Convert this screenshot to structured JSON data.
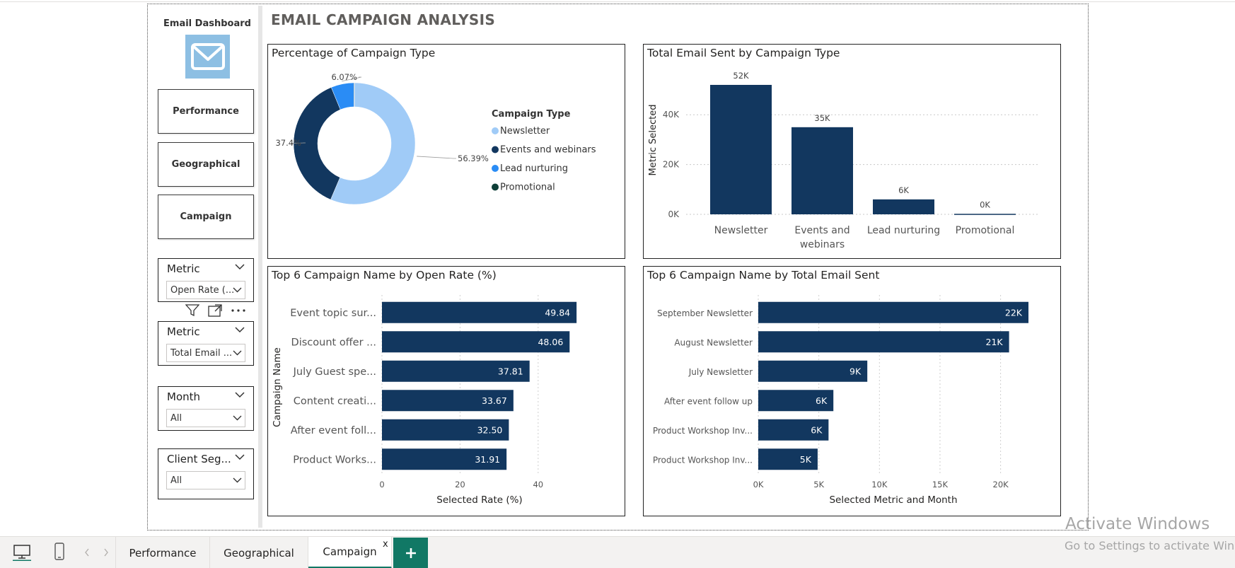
{
  "nav": {
    "dashboard_title": "Email Dashboard",
    "buttons": [
      {
        "label": "Performance"
      },
      {
        "label": "Geographical"
      },
      {
        "label": "Campaign"
      }
    ]
  },
  "slicers": [
    {
      "title": "Metric",
      "value": "Open Rate (..."
    },
    {
      "title": "Metric",
      "value": "Total Email ..."
    },
    {
      "title": "Month",
      "value": "All"
    },
    {
      "title": "Client Seg...",
      "value": "All"
    }
  ],
  "page_title": "EMAIL CAMPAIGN ANALYSIS",
  "colors": {
    "newsletter": "#a0cbf7",
    "events": "#12375f",
    "lead": "#2a8cf5",
    "promotional": "#0e3f38",
    "bar": "#12375f",
    "tab_accent": "#117865"
  },
  "chart_data": [
    {
      "type": "pie",
      "title": "Percentage of Campaign Type",
      "legend_title": "Campaign Type",
      "legend_position": "right",
      "slices": [
        {
          "name": "Newsletter",
          "value": 56.39,
          "label": "56.39%"
        },
        {
          "name": "Events and webinars",
          "value": 37.4,
          "label": "37.4%"
        },
        {
          "name": "Lead nurturing",
          "value": 6.07,
          "label": "6.07%"
        },
        {
          "name": "Promotional",
          "value": 0.14,
          "label": ""
        }
      ]
    },
    {
      "type": "bar",
      "title": "Total Email Sent by Campaign Type",
      "ylabel": "Metric Selected",
      "xlabel": "",
      "categories": [
        "Newsletter",
        "Events and webinars",
        "Lead nurturing",
        "Promotional"
      ],
      "category_lines": [
        [
          "Newsletter"
        ],
        [
          "Events and",
          "webinars"
        ],
        [
          "Lead nurturing"
        ],
        [
          "Promotional"
        ]
      ],
      "values": [
        52000,
        35000,
        6000,
        200
      ],
      "data_labels": [
        "52K",
        "35K",
        "6K",
        "0K"
      ],
      "ylim": [
        0,
        52000
      ],
      "yticks": [
        0,
        20000,
        40000
      ],
      "ytick_labels": [
        "0K",
        "20K",
        "40K"
      ],
      "grid": true
    },
    {
      "type": "bar",
      "orientation": "horizontal",
      "title": "Top 6 Campaign Name by Open Rate (%)",
      "ylabel": "Campaign Name",
      "xlabel": "Selected Rate (%)",
      "categories": [
        "Event topic sur...",
        "Discount offer ...",
        "July Guest spe...",
        "Content creati...",
        "After event foll...",
        "Product Works..."
      ],
      "values": [
        49.84,
        48.06,
        37.81,
        33.67,
        32.5,
        31.91
      ],
      "data_labels": [
        "49.84",
        "48.06",
        "37.81",
        "33.67",
        "32.50",
        "31.91"
      ],
      "xlim": [
        0,
        50
      ],
      "xticks": [
        0,
        20,
        40
      ],
      "xtick_labels": [
        "0",
        "20",
        "40"
      ],
      "grid": true
    },
    {
      "type": "bar",
      "orientation": "horizontal",
      "title": "Top 6 Campaign Name by Total Email Sent",
      "ylabel": "",
      "xlabel": "Selected Metric and Month",
      "categories": [
        "September Newsletter",
        "August Newsletter",
        "July Newsletter",
        "After event follow up",
        "Product Workshop Inv...",
        "Product Workshop Inv..."
      ],
      "values": [
        22300,
        20700,
        9000,
        6200,
        5800,
        4900
      ],
      "data_labels": [
        "22K",
        "21K",
        "9K",
        "6K",
        "6K",
        "5K"
      ],
      "xlim": [
        0,
        22300
      ],
      "xticks": [
        0,
        5000,
        10000,
        15000,
        20000
      ],
      "xtick_labels": [
        "0K",
        "5K",
        "10K",
        "15K",
        "20K"
      ],
      "grid": true
    }
  ],
  "tabs": [
    {
      "label": "Performance",
      "active": false
    },
    {
      "label": "Geographical",
      "active": false
    },
    {
      "label": "Campaign",
      "active": true
    }
  ],
  "tab_close": "x",
  "watermark": {
    "title": "Activate Windows",
    "subtitle": "Go to Settings to activate Windows."
  }
}
